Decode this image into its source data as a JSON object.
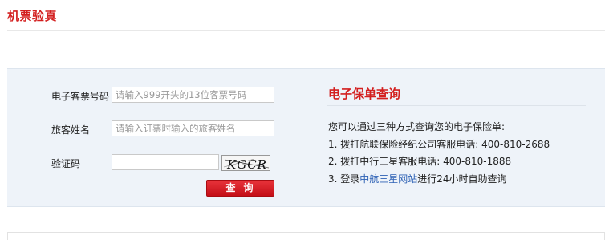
{
  "page": {
    "title": "机票验真"
  },
  "form": {
    "ticket_label": "电子客票号码",
    "ticket_placeholder": "请输入999开头的13位客票号码",
    "name_label": "旅客姓名",
    "name_placeholder": "请输入订票时输入的旅客姓名",
    "captcha_label": "验证码",
    "captcha_value": "",
    "captcha_text": "KGCR",
    "query_label": "查询"
  },
  "insurance": {
    "title": "电子保单查询",
    "intro": "您可以通过三种方式查询您的电子保险单:",
    "line1": "1. 拨打航联保险经纪公司客服电话: 400-810-2688",
    "line2": "2. 拨打中行三星客服电话: 400-810-1888",
    "line3_prefix": "3. 登录",
    "line3_link": "中航三星网站",
    "line3_suffix": "进行24小时自助查询"
  },
  "colors": {
    "accent": "#d31f1f",
    "link": "#2e62b5",
    "panel_bg": "#eef3f9"
  }
}
